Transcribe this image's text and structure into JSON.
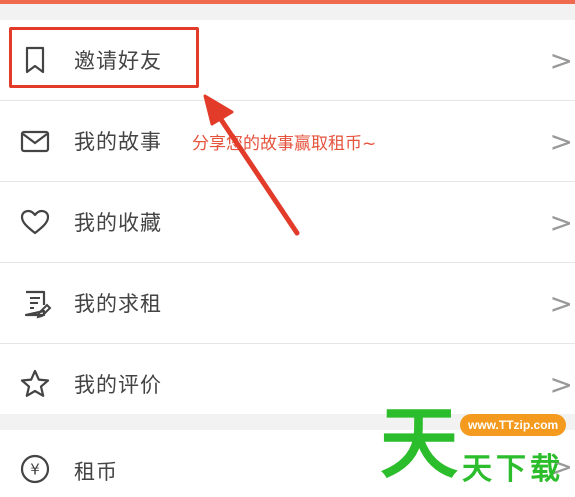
{
  "menu": {
    "items": [
      {
        "label": "邀请好友",
        "icon": "bookmark-icon"
      },
      {
        "label": "我的故事",
        "icon": "mail-icon",
        "promo": "分享您的故事赢取租币~"
      },
      {
        "label": "我的收藏",
        "icon": "heart-icon"
      },
      {
        "label": "我的求租",
        "icon": "clipboard-edit-icon"
      },
      {
        "label": "我的评价",
        "icon": "star-icon"
      }
    ],
    "chevron": ">"
  },
  "bottom": {
    "label": "租币",
    "icon": "yen-icon",
    "icon_text": "¥"
  },
  "watermark": {
    "big": "天",
    "pill": "www.TTzip.com",
    "sub": "天下载"
  },
  "colors": {
    "highlight": "#e23b2a",
    "promo": "#e5533d",
    "watermark_green": "#2bbd2b",
    "watermark_orange": "#f39a1f"
  }
}
